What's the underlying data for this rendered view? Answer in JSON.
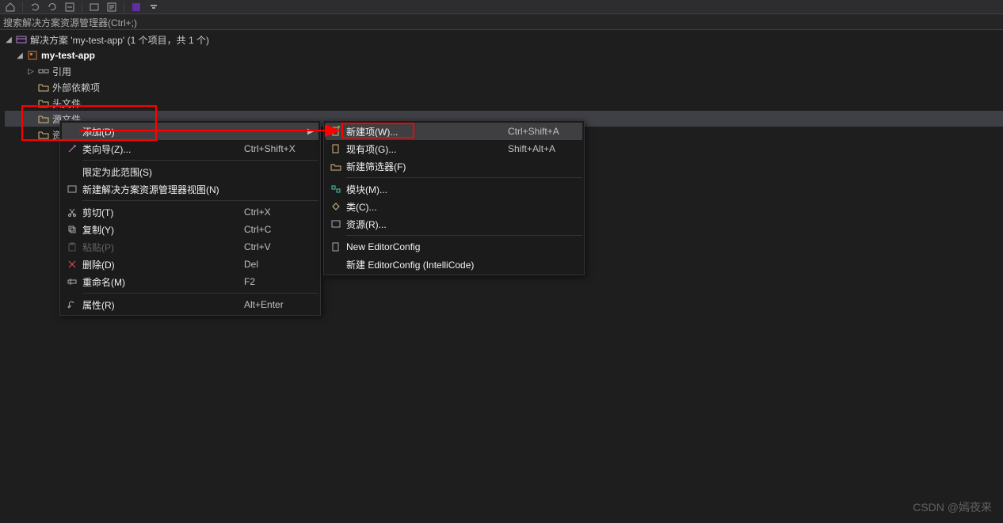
{
  "search": {
    "placeholder": "搜索解决方案资源管理器(Ctrl+;)"
  },
  "tree": {
    "solution": "解决方案 'my-test-app' (1 个项目，共 1 个)",
    "project": "my-test-app",
    "items": {
      "references": "引用",
      "external": "外部依赖项",
      "headers": "头文件",
      "sources": "源文件",
      "resources": "资..."
    }
  },
  "menu1": {
    "add": "添加(D)",
    "classwizard": "类向导(Z)...",
    "classwizard_sc": "Ctrl+Shift+X",
    "scope": "限定为此范围(S)",
    "newview": "新建解决方案资源管理器视图(N)",
    "cut": "剪切(T)",
    "cut_sc": "Ctrl+X",
    "copy": "复制(Y)",
    "copy_sc": "Ctrl+C",
    "paste": "粘贴(P)",
    "paste_sc": "Ctrl+V",
    "delete": "删除(D)",
    "delete_sc": "Del",
    "rename": "重命名(M)",
    "rename_sc": "F2",
    "props": "属性(R)",
    "props_sc": "Alt+Enter"
  },
  "menu2": {
    "newitem": "新建项(W)...",
    "newitem_sc": "Ctrl+Shift+A",
    "existing": "现有项(G)...",
    "existing_sc": "Shift+Alt+A",
    "newfilter": "新建筛选器(F)",
    "module": "模块(M)...",
    "classitem": "类(C)...",
    "resource": "资源(R)...",
    "neweditorconfig": "New EditorConfig",
    "editorconfig_ic": "新建 EditorConfig (IntelliCode)"
  },
  "watermark": "CSDN @嫣夜来"
}
